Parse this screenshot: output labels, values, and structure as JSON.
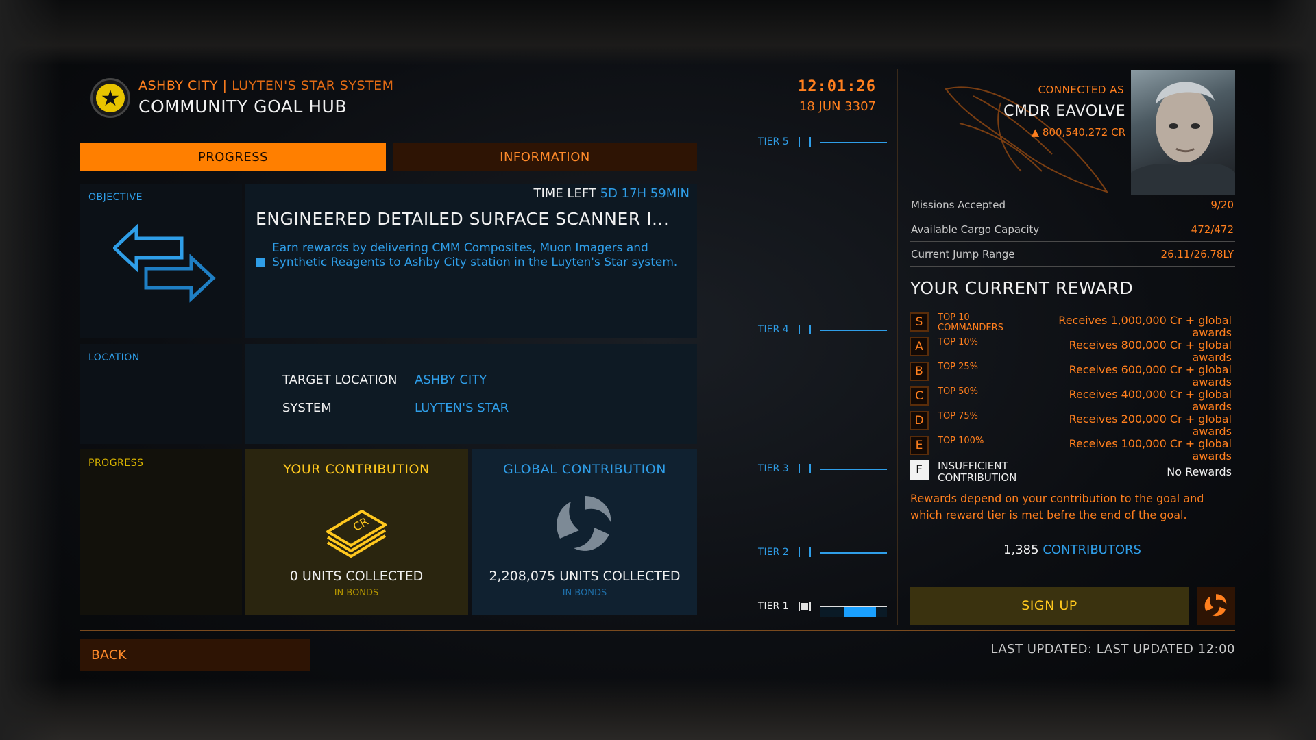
{
  "header": {
    "station": "ASHBY CITY",
    "separator": "|",
    "system": "LUYTEN'S STAR SYSTEM",
    "title": "COMMUNITY GOAL HUB",
    "time": "12:01:26",
    "date": "18 JUN 3307"
  },
  "tabs": [
    {
      "label": "PROGRESS",
      "active": true
    },
    {
      "label": "INFORMATION",
      "active": false
    }
  ],
  "objective": {
    "section_label": "OBJECTIVE",
    "time_left_label": "TIME LEFT",
    "time_left_value": "5D 17H 59MIN",
    "title": "ENGINEERED DETAILED SURFACE SCANNER I...",
    "description": "Earn rewards by delivering CMM Composites, Muon Imagers and Synthetic Reagents to Ashby City station in the Luyten's Star system."
  },
  "location": {
    "section_label": "LOCATION",
    "target_key": "TARGET LOCATION",
    "target_value": "ASHBY CITY",
    "system_key": "SYSTEM",
    "system_value": "LUYTEN'S STAR"
  },
  "progress": {
    "section_label": "PROGRESS",
    "your": {
      "title": "YOUR CONTRIBUTION",
      "count": "0 UNITS COLLECTED",
      "sub": "IN BONDS"
    },
    "global": {
      "title": "GLOBAL CONTRIBUTION",
      "count": "2,208,075 UNITS COLLECTED",
      "sub": "IN BONDS"
    }
  },
  "tiers": {
    "labels": [
      "TIER 5",
      "TIER 4",
      "TIER 3",
      "TIER 2",
      "TIER 1"
    ],
    "current_tier": 1
  },
  "footer": {
    "back_label": "BACK",
    "last_updated": "LAST UPDATED: LAST UPDATED 12:00"
  },
  "commander": {
    "connected_as": "CONNECTED AS",
    "name": "CMDR EAVOLVE",
    "credits": "800,540,272 CR"
  },
  "stats": [
    {
      "label": "Missions Accepted",
      "value": "9/20"
    },
    {
      "label": "Available Cargo Capacity",
      "value": "472/472"
    },
    {
      "label": "Current Jump Range",
      "value": "26.11/26.78LY"
    }
  ],
  "reward": {
    "heading": "YOUR CURRENT REWARD",
    "rows": [
      {
        "badge": "S",
        "name": "TOP 10 COMMANDERS",
        "reward": "Receives 1,000,000 Cr + global awards"
      },
      {
        "badge": "A",
        "name": "TOP 10%",
        "reward": "Receives 800,000 Cr + global awards"
      },
      {
        "badge": "B",
        "name": "TOP 25%",
        "reward": "Receives 600,000 Cr + global awards"
      },
      {
        "badge": "C",
        "name": "TOP 50%",
        "reward": "Receives 400,000 Cr + global awards"
      },
      {
        "badge": "D",
        "name": "TOP 75%",
        "reward": "Receives 200,000 Cr + global awards"
      },
      {
        "badge": "E",
        "name": "TOP 100%",
        "reward": "Receives 100,000 Cr + global awards"
      },
      {
        "badge": "F",
        "name": "INSUFFICIENT CONTRIBUTION",
        "reward": "No Rewards"
      }
    ],
    "active_row": 6,
    "note": "Rewards depend on your contribution to the goal and which reward tier is met befre the end of the goal.",
    "contributors_count": "1,385",
    "contributors_label": "CONTRIBUTORS",
    "signup_label": "SIGN UP"
  },
  "colors": {
    "accent_orange": "#ff7f1e",
    "accent_blue": "#2f9ee8",
    "signup_yellow": "#ffc81e"
  },
  "icons": {
    "faction": "star-emblem-icon",
    "objective": "exchange-arrows-icon",
    "your_contribution": "credit-bonds-icon",
    "global_contribution": "swirl-logo-icon"
  }
}
